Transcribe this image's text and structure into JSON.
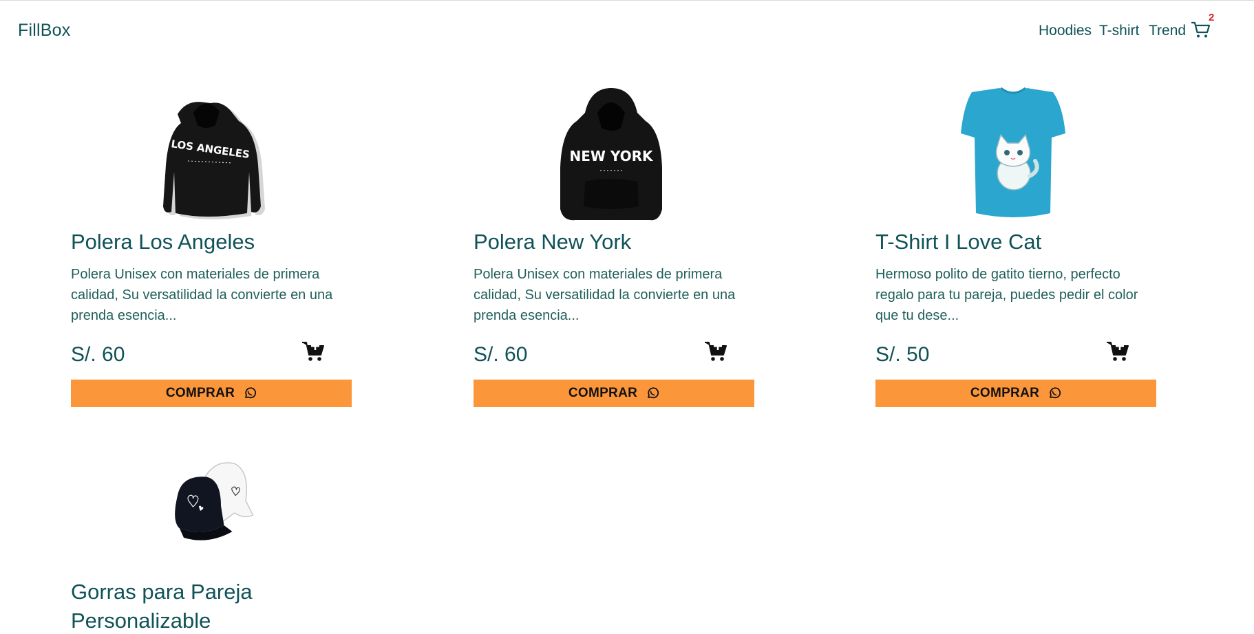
{
  "brand": "FillBox",
  "nav": {
    "links": [
      "Hoodies",
      "T-shirt",
      "Trend"
    ],
    "cart_count": "2"
  },
  "colors": {
    "primary": "#0f5257",
    "buy_button": "#fb963b",
    "badge": "#e01d1d",
    "tshirt": "#2aa6cf"
  },
  "products": [
    {
      "title": "Polera Los Angeles",
      "description": "Polera Unisex con materiales de primera calidad, Su versatilidad la convierte en una prenda esencia...",
      "price": "S/. 60",
      "buy_label": "COMPRAR",
      "image_text": "LOS ANGELES",
      "image_icon": "hoodie-black-icon"
    },
    {
      "title": "Polera New York",
      "description": "Polera Unisex con materiales de primera calidad, Su versatilidad la convierte en una prenda esencia...",
      "price": "S/. 60",
      "buy_label": "COMPRAR",
      "image_text": "NEW YORK",
      "image_icon": "hoodie-black-icon"
    },
    {
      "title": "T-Shirt I Love Cat",
      "description": "Hermoso polito de gatito tierno, perfecto regalo para tu pareja, puedes pedir el color que tu dese...",
      "price": "S/. 50",
      "buy_label": "COMPRAR",
      "image_icon": "tshirt-cat-icon"
    },
    {
      "title": "Gorras para Pareja Personalizable",
      "image_icon": "couple-caps-icon"
    }
  ]
}
